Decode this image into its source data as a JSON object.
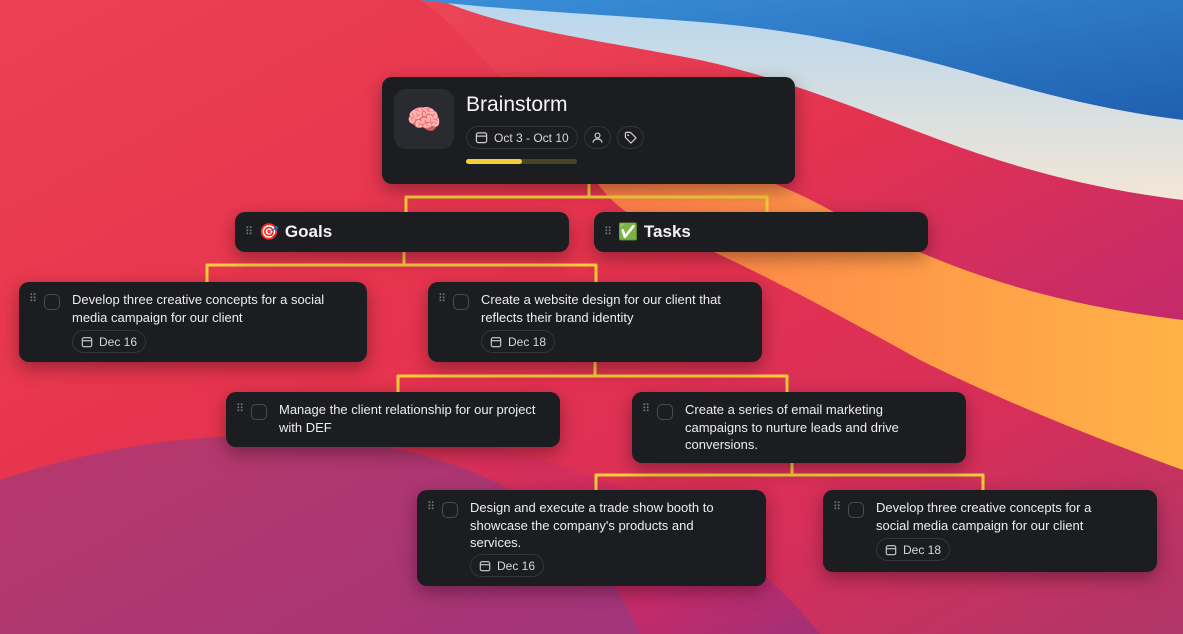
{
  "root": {
    "icon": "brain-emoji",
    "icon_glyph": "🧠",
    "title": "Brainstorm",
    "date_range": "Oct 3 - Oct 10",
    "progress": 0.5
  },
  "sections": [
    {
      "emoji": "🎯",
      "label": "Goals"
    },
    {
      "emoji": "✅",
      "label": "Tasks"
    }
  ],
  "tasks": [
    {
      "text_lines": [
        "Develop three creative concepts for a social",
        "media campaign for our client"
      ],
      "date": "Dec 16"
    },
    {
      "text_lines": [
        "Create a website design for our client that",
        "reflects their brand identity"
      ],
      "date": "Dec 18"
    },
    {
      "text_lines": [
        "Manage the client relationship for our project",
        "with DEF"
      ],
      "date": ""
    },
    {
      "text_lines": [
        "Create a series of email marketing",
        "campaigns to nurture leads and drive",
        "conversions."
      ],
      "date": ""
    },
    {
      "text_lines": [
        "Design and execute a trade show booth to",
        "showcase the company's products and",
        "services."
      ],
      "date": "Dec 16"
    },
    {
      "text_lines": [
        "Develop three creative concepts for a",
        "social media campaign for our client"
      ],
      "date": "Dec 18"
    }
  ],
  "colors": {
    "card_bg": "#1c1d21",
    "connector": "#f2cf3a",
    "progress_fill": "#f2cf3a"
  }
}
